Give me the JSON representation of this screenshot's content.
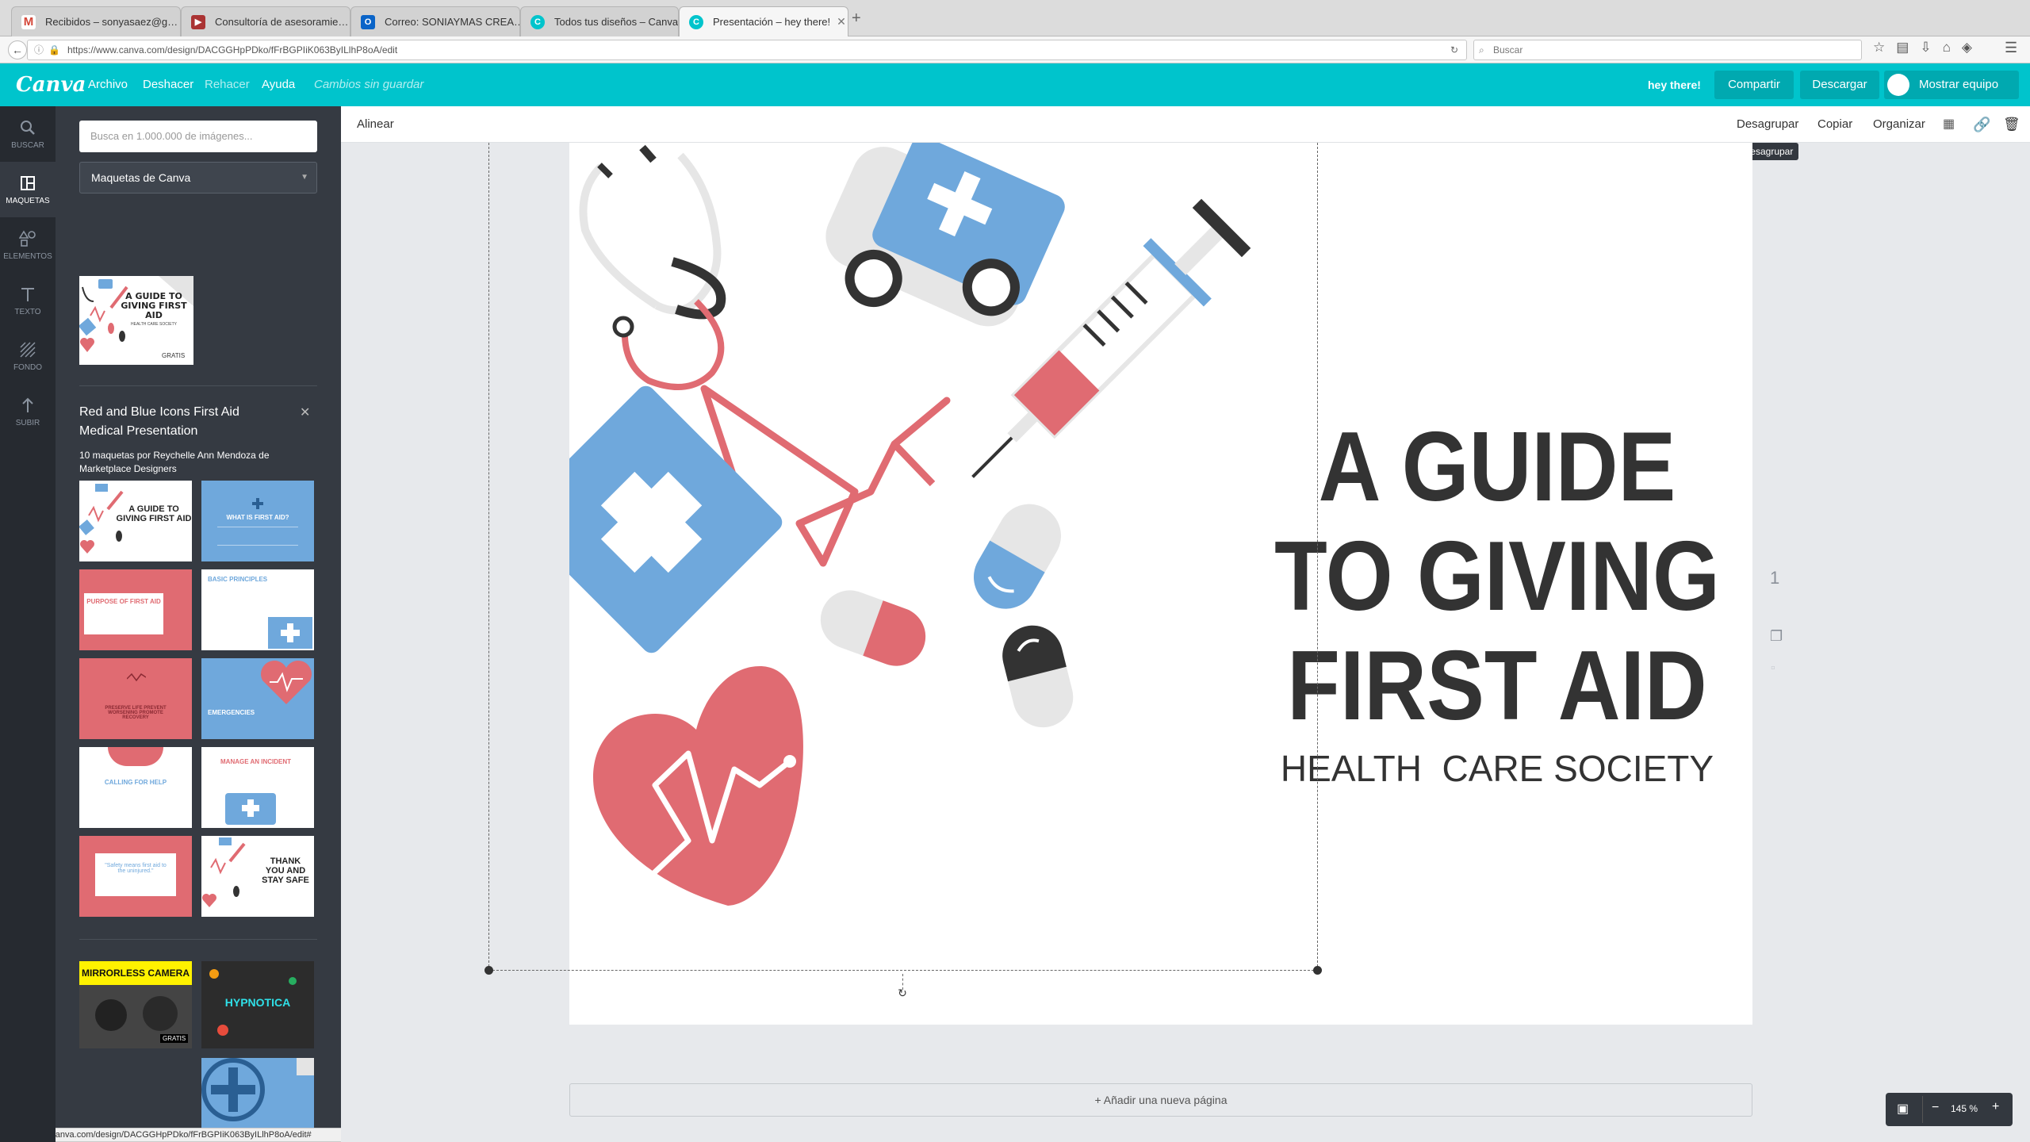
{
  "browser": {
    "tabs": [
      {
        "label": "Recibidos – sonyasaez@g…",
        "icon": "gmail-icon"
      },
      {
        "label": "Consultoría de asesoramie…",
        "icon": "flag-icon"
      },
      {
        "label": "Correo: SONIAYMAS CREA…",
        "icon": "outlook-icon"
      },
      {
        "label": "Todos tus diseños – Canva",
        "icon": "canva-icon"
      },
      {
        "label": "Presentación – hey there!",
        "icon": "canva-icon"
      }
    ],
    "url": "https://www.canva.com/design/DACGGHpPDko/fFrBGPIiK063ByILlhP8oA/edit",
    "search_placeholder": "Buscar",
    "status_url": "https://www.canva.com/design/DACGGHpPDko/fFrBGPIiK063ByILlhP8oA/edit#"
  },
  "header": {
    "logo": "Canva",
    "menu": [
      "Archivo",
      "Deshacer",
      "Rehacer",
      "Ayuda"
    ],
    "unsaved": "Cambios sin guardar",
    "greeting": "hey there!",
    "share": "Compartir",
    "download": "Descargar",
    "team": "Mostrar equipo"
  },
  "rail": [
    {
      "label": "BUSCAR",
      "icon": "search-icon"
    },
    {
      "label": "MAQUETAS",
      "icon": "layout-icon"
    },
    {
      "label": "ELEMENTOS",
      "icon": "shapes-icon"
    },
    {
      "label": "TEXTO",
      "icon": "text-icon"
    },
    {
      "label": "FONDO",
      "icon": "background-icon"
    },
    {
      "label": "SUBIR",
      "icon": "upload-icon"
    }
  ],
  "panel": {
    "search_placeholder": "Busca en 1.000.000 de imágenes...",
    "dropdown": "Maquetas de Canva",
    "free_badge": "GRATIS",
    "collection_title": "Red and Blue Icons First Aid Medical Presentation",
    "collection_meta": "10 maquetas por Reychelle Ann Mendoza de Marketplace Designers",
    "thumbs": [
      {
        "title": "A GUIDE TO GIVING FIRST AID",
        "sub": "HEALTH CARE SOCIETY"
      },
      {
        "title": "WHAT IS FIRST AID?"
      },
      {
        "title": "PURPOSE OF FIRST AID"
      },
      {
        "title": "BASIC PRINCIPLES"
      },
      {
        "title": "PRESERVE LIFE PREVENT WORSENING PROMOTE RECOVERY"
      },
      {
        "title": "EMERGENCIES"
      },
      {
        "title": "CALLING FOR HELP"
      },
      {
        "title": "MANAGE AN INCIDENT"
      },
      {
        "title": "\"Safety means first aid to the uninjured.\""
      },
      {
        "title": "THANK YOU AND STAY SAFE"
      }
    ],
    "other_thumbs": [
      {
        "title": "MIRRORLESS CAMERA"
      },
      {
        "title": "HYPNOTICA"
      },
      {
        "title": ""
      }
    ]
  },
  "toolbar": {
    "align": "Alinear",
    "ungroup": "Desagrupar",
    "copy": "Copiar",
    "arrange": "Organizar",
    "tooltip": "Desagrupar"
  },
  "slide": {
    "title_lines": [
      "A GUIDE",
      "TO GIVING",
      "FIRST AID"
    ],
    "subtitle": "HEALTH  CARE SOCIETY",
    "page_number": "1",
    "colors": {
      "red": "#e06b72",
      "blue": "#6fa8dc",
      "dark": "#333333",
      "grey": "#e6e6e6"
    }
  },
  "footer": {
    "add_page": "+ Añadir una nueva página",
    "zoom": "145 %"
  }
}
